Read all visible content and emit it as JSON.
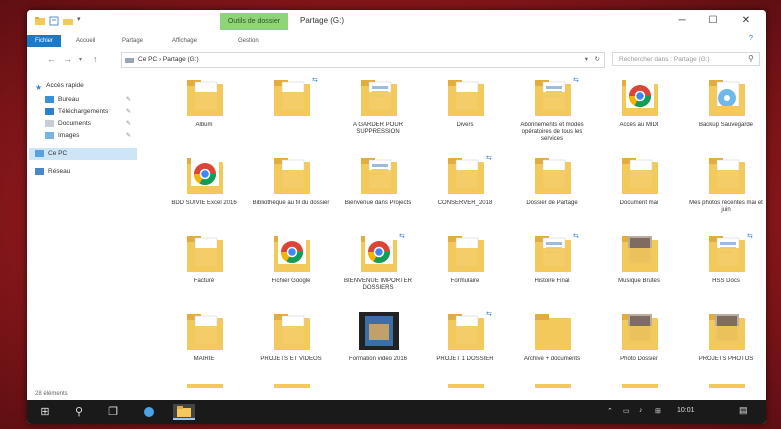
{
  "window": {
    "context_tab": "Outils de dossier",
    "title": "Partage (G:)",
    "min": "─",
    "max": "☐",
    "close": "✕"
  },
  "ribbon": {
    "tabs": [
      "Fichier",
      "Accueil",
      "Partage",
      "Affichage",
      "Gestion"
    ]
  },
  "address": {
    "back": "←",
    "forward": "→",
    "up": "↑",
    "path": "Ce PC › Partage (G:)",
    "refresh": "↻",
    "search_placeholder": "Rechercher dans : Partage (G:)"
  },
  "nav": {
    "items": [
      {
        "label": "Accès rapide",
        "icon": "star-icon"
      },
      {
        "label": "Bureau",
        "icon": "desktop-icon"
      },
      {
        "label": "Téléchargements",
        "icon": "download-icon"
      },
      {
        "label": "Documents",
        "icon": "documents-icon"
      },
      {
        "label": "Images",
        "icon": "pictures-icon"
      },
      {
        "label": "Ce PC",
        "icon": "pc-icon"
      },
      {
        "label": "Réseau",
        "icon": "network-icon"
      }
    ]
  },
  "content": {
    "items": [
      {
        "label": "Album",
        "kind": "folder",
        "sync": false
      },
      {
        "label": "",
        "kind": "folder",
        "sync": true
      },
      {
        "label": "A GARDER POUR SUPPRESSION",
        "kind": "doc-folder",
        "sync": false
      },
      {
        "label": "Divers",
        "kind": "folder",
        "sync": false
      },
      {
        "label": "Abonnements et modes opératoires de tous les services",
        "kind": "doc-folder",
        "sync": true
      },
      {
        "label": "Accès au MIDI",
        "kind": "chrome",
        "sync": false
      },
      {
        "label": "Backup Sauvegarde",
        "kind": "disc",
        "sync": false
      },
      {
        "label": "BDD SUIVIE Excel 2016",
        "kind": "chrome",
        "sync": false
      },
      {
        "label": "Bibliothèque au fil du dossier",
        "kind": "folder",
        "sync": false
      },
      {
        "label": "Bienvenue dans Projects",
        "kind": "doc-folder",
        "sync": false
      },
      {
        "label": "CONSERVER_2018",
        "kind": "folder",
        "sync": true
      },
      {
        "label": "Dossier de Partage",
        "kind": "folder",
        "sync": false
      },
      {
        "label": "Document mai",
        "kind": "folder",
        "sync": false
      },
      {
        "label": "Mes photos récentes mai et juin",
        "kind": "folder",
        "sync": false
      },
      {
        "label": "Facturé",
        "kind": "folder",
        "sync": false
      },
      {
        "label": "Fichier Google",
        "kind": "chrome",
        "sync": false
      },
      {
        "label": "BIENVENUE IMPORTER DOSSIERS",
        "kind": "chrome",
        "sync": true
      },
      {
        "label": "Formulaire",
        "kind": "folder",
        "sync": false
      },
      {
        "label": "Histoire Final",
        "kind": "doc-folder",
        "sync": true
      },
      {
        "label": "Musique Brutes",
        "kind": "photo-folder",
        "sync": false
      },
      {
        "label": "HSS Docs",
        "kind": "doc-folder",
        "sync": true
      },
      {
        "label": "MAIRIE",
        "kind": "folder",
        "sync": false
      },
      {
        "label": "PROJETS ET VIDEOS",
        "kind": "folder",
        "sync": false
      },
      {
        "label": "Formation video 2016",
        "kind": "video",
        "sync": false
      },
      {
        "label": "PROJET 1 DOSSIER",
        "kind": "folder",
        "sync": true
      },
      {
        "label": "Archive + documents",
        "kind": "folder-open",
        "sync": false
      },
      {
        "label": "Photo Dossier",
        "kind": "photo-folder",
        "sync": false
      },
      {
        "label": "PROJETS PHOTOS",
        "kind": "photo-folder",
        "sync": false
      }
    ]
  },
  "status": {
    "text": "28 éléments"
  },
  "taskbar": {
    "start": "⊞",
    "search": "⚲",
    "taskview": "❐",
    "time": "10:01"
  },
  "colors": {
    "folder": "#f3c95b",
    "folder_dark": "#e2ad3c",
    "accent": "#1979ca",
    "context_tab": "#8fd37b"
  }
}
